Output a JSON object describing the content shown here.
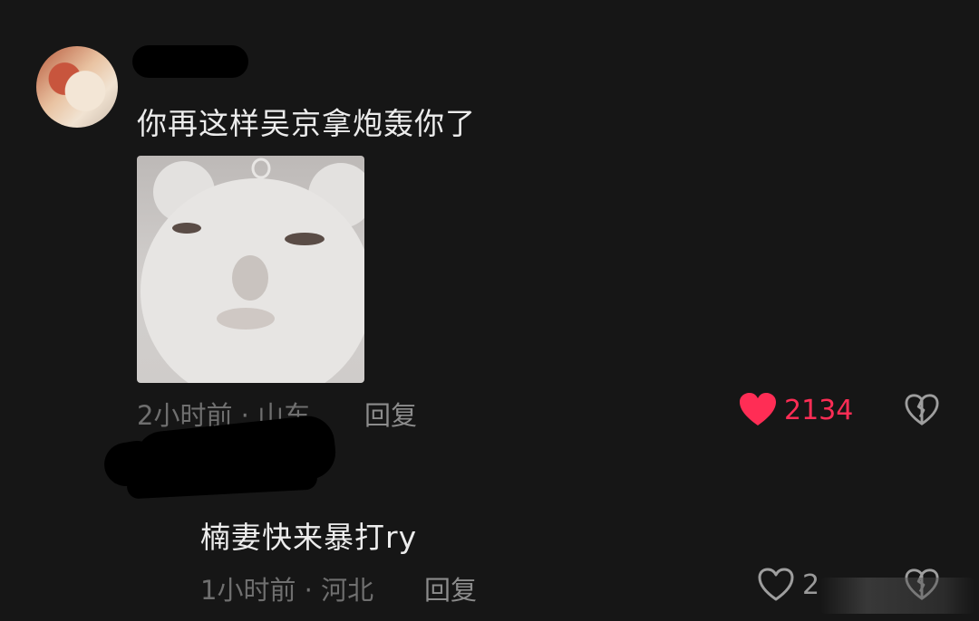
{
  "comment1": {
    "text": "你再这样吴京拿炮轰你了",
    "time": "2小时前",
    "location": "山东",
    "reply_label": "回复",
    "like_count": "2134",
    "sticker_icon": "bear-face-sticker"
  },
  "comment2": {
    "text": "楠妻快来暴打ry",
    "time": "1小时前",
    "location": "河北",
    "reply_label": "回复",
    "like_count": "2"
  },
  "colors": {
    "background": "#161616",
    "like_active": "#ff2d55",
    "meta_text": "#6f6f6f"
  },
  "separator": "·"
}
